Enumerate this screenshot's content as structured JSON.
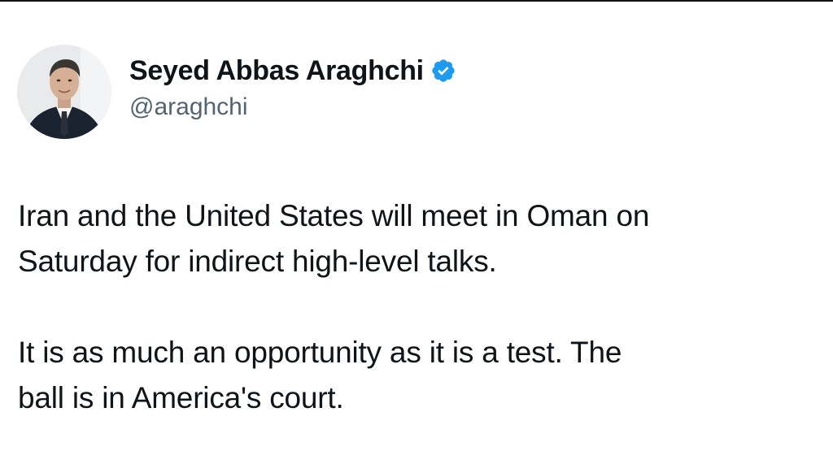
{
  "author": {
    "display_name": "Seyed Abbas Araghchi",
    "handle": "@araghchi",
    "verified_icon": "verified-badge-icon",
    "avatar_icon": "profile-photo"
  },
  "tweet": {
    "paragraph1_line1": "Iran and the United States will meet in Oman on",
    "paragraph1_line2": "Saturday for indirect high-level talks.",
    "paragraph2_line1": "It is as much an opportunity as it is a test. The",
    "paragraph2_line2": "ball is in America's court."
  },
  "colors": {
    "text": "#0f1419",
    "secondary_text": "#536471",
    "verified_blue": "#1d9bf0",
    "background": "#ffffff"
  }
}
